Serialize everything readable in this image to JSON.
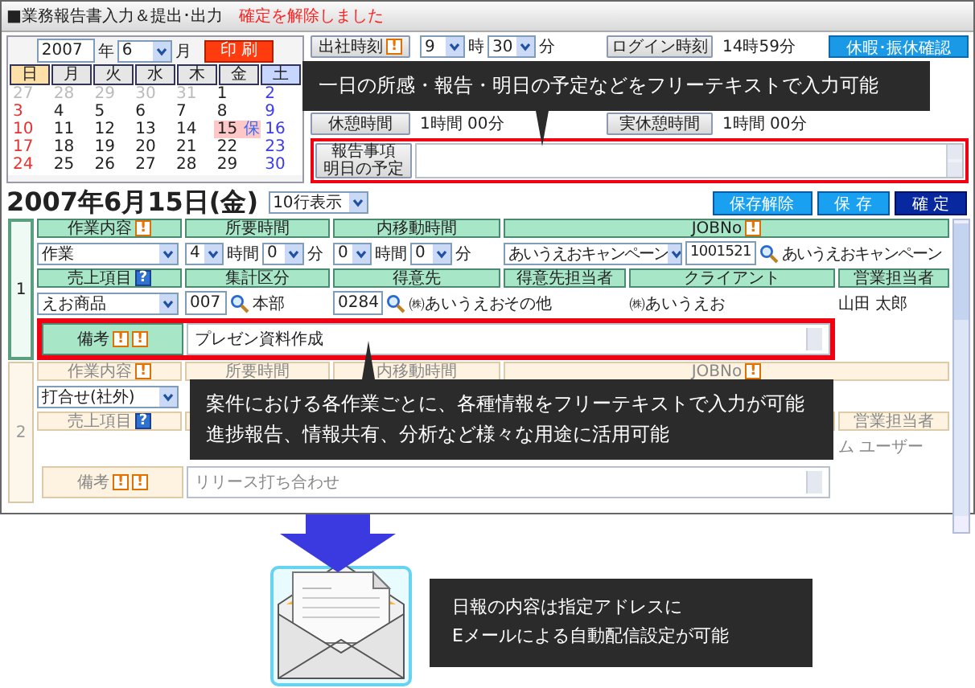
{
  "window": {
    "title": "■業務報告書入力＆提出･出力",
    "status": "確定を解除しました"
  },
  "calendar": {
    "year": "2007",
    "year_unit": "年",
    "month": "6",
    "month_unit": "月",
    "print_button": "印 刷",
    "weekdays": [
      {
        "label": "日",
        "kind": "sun"
      },
      {
        "label": "月",
        "kind": "weekday"
      },
      {
        "label": "火",
        "kind": "weekday"
      },
      {
        "label": "水",
        "kind": "weekday"
      },
      {
        "label": "木",
        "kind": "weekday"
      },
      {
        "label": "金",
        "kind": "weekday"
      },
      {
        "label": "土",
        "kind": "sat"
      }
    ],
    "weeks": [
      [
        {
          "day": "27",
          "kind": "other",
          "selected": false
        },
        {
          "day": "28",
          "kind": "other",
          "selected": false
        },
        {
          "day": "29",
          "kind": "other",
          "selected": false
        },
        {
          "day": "30",
          "kind": "other",
          "selected": false
        },
        {
          "day": "31",
          "kind": "other",
          "selected": false
        },
        {
          "day": "1",
          "kind": "weekday",
          "selected": false
        },
        {
          "day": "2",
          "kind": "sat",
          "selected": false
        }
      ],
      [
        {
          "day": "3",
          "kind": "sun",
          "selected": false
        },
        {
          "day": "4",
          "kind": "weekday",
          "selected": false
        },
        {
          "day": "5",
          "kind": "weekday",
          "selected": false
        },
        {
          "day": "6",
          "kind": "weekday",
          "selected": false
        },
        {
          "day": "7",
          "kind": "weekday",
          "selected": false
        },
        {
          "day": "8",
          "kind": "weekday",
          "selected": false
        },
        {
          "day": "9",
          "kind": "sat",
          "selected": false
        }
      ],
      [
        {
          "day": "10",
          "kind": "sun",
          "selected": false
        },
        {
          "day": "11",
          "kind": "weekday",
          "selected": false
        },
        {
          "day": "12",
          "kind": "weekday",
          "selected": false
        },
        {
          "day": "13",
          "kind": "weekday",
          "selected": false
        },
        {
          "day": "14",
          "kind": "weekday",
          "selected": false
        },
        {
          "day": "15",
          "kind": "weekday",
          "selected": true,
          "badge": "保"
        },
        {
          "day": "16",
          "kind": "sat",
          "selected": false
        }
      ],
      [
        {
          "day": "17",
          "kind": "sun",
          "selected": false
        },
        {
          "day": "18",
          "kind": "weekday",
          "selected": false
        },
        {
          "day": "19",
          "kind": "weekday",
          "selected": false
        },
        {
          "day": "20",
          "kind": "weekday",
          "selected": false
        },
        {
          "day": "21",
          "kind": "weekday",
          "selected": false
        },
        {
          "day": "22",
          "kind": "weekday",
          "selected": false
        },
        {
          "day": "23",
          "kind": "sat",
          "selected": false
        }
      ],
      [
        {
          "day": "24",
          "kind": "sun",
          "selected": false
        },
        {
          "day": "25",
          "kind": "weekday",
          "selected": false
        },
        {
          "day": "26",
          "kind": "weekday",
          "selected": false
        },
        {
          "day": "27",
          "kind": "weekday",
          "selected": false
        },
        {
          "day": "28",
          "kind": "weekday",
          "selected": false
        },
        {
          "day": "29",
          "kind": "weekday",
          "selected": false
        },
        {
          "day": "30",
          "kind": "sat",
          "selected": false
        }
      ]
    ]
  },
  "attendance": {
    "arrive": {
      "label": "出社時刻",
      "icons": [
        {
          "kind": "alert",
          "glyph": "!"
        }
      ],
      "hour": "9",
      "hour_unit": "時",
      "minute": "30",
      "minute_unit": "分"
    },
    "login": {
      "label": "ログイン時刻",
      "value": "14時59分"
    },
    "leave_button": "休暇･振休確認",
    "break": {
      "label": "休憩時間",
      "value": "1時間 00分"
    },
    "actual_break": {
      "label": "実休憩時間",
      "value": "1時間 00分"
    },
    "report": {
      "label_lines": [
        "報告事項",
        "明日の予定"
      ],
      "highlighted": true
    }
  },
  "day_header": {
    "date": "2007年6月15日(金)",
    "rows_select": "10行表示",
    "buttons": [
      {
        "label": "保存解除",
        "kind": "secondary"
      },
      {
        "label": "保 存",
        "kind": "secondary"
      },
      {
        "label": "確 定",
        "kind": "primary"
      }
    ]
  },
  "tasks": [
    {
      "number": "1",
      "active": true,
      "headers": {
        "work": {
          "label": "作業内容",
          "icons": [
            {
              "kind": "alert",
              "glyph": "!"
            }
          ]
        },
        "duration": {
          "label": "所要時間"
        },
        "travel": {
          "label": "内移動時間"
        },
        "job": {
          "label": "JOBNo",
          "icons": [
            {
              "kind": "alert",
              "glyph": "!"
            }
          ]
        },
        "sales_item": {
          "label": "売上項目",
          "icons": [
            {
              "kind": "help",
              "glyph": "?"
            }
          ]
        },
        "tally": {
          "label": "集計区分"
        },
        "customer": {
          "label": "得意先"
        },
        "customer_contact": {
          "label": "得意先担当者"
        },
        "client": {
          "label": "クライアント"
        },
        "sales_rep": {
          "label": "営業担当者"
        }
      },
      "values": {
        "work_type": "作業",
        "duration_hours": "4",
        "duration_hour_unit": "時間",
        "duration_minutes": "0",
        "duration_minute_unit": "分",
        "travel_hours": "0",
        "travel_hour_unit": "時間",
        "travel_minutes": "0",
        "travel_minute_unit": "分",
        "job_select": "あいうえおキャンペーン",
        "job_no": "1001521",
        "job_name": "あいうえおキャンペーン",
        "sales_item": "えお商品",
        "tally_code": "007",
        "tally_name": "本部",
        "customer_code": "0284",
        "customer_name": "㈱あいうえお",
        "customer_contact": "その他",
        "client": "㈱あいうえお",
        "sales_rep": "山田 太郎"
      },
      "note": {
        "label": "備考",
        "icons": [
          {
            "kind": "alert",
            "glyph": "!"
          },
          {
            "kind": "alert",
            "glyph": "!"
          }
        ],
        "text": "プレゼン資料作成",
        "highlighted": true
      }
    },
    {
      "number": "2",
      "active": false,
      "headers": {
        "work": {
          "label": "作業内容",
          "icons": [
            {
              "kind": "alert",
              "glyph": "!"
            }
          ]
        },
        "duration": {
          "label": "所要時間"
        },
        "travel": {
          "label": "内移動時間"
        },
        "job": {
          "label": "JOBNo",
          "icons": [
            {
              "kind": "alert",
              "glyph": "!"
            }
          ]
        },
        "sales_item": {
          "label": "売上項目",
          "icons": [
            {
              "kind": "help",
              "glyph": "?"
            }
          ]
        },
        "sales_rep": {
          "label": "営業担当者"
        }
      },
      "values": {
        "work_type": "打合せ(社外)",
        "sales_rep": "ム ユーザー"
      },
      "note": {
        "label": "備考",
        "icons": [
          {
            "kind": "alert",
            "glyph": "!"
          },
          {
            "kind": "alert",
            "glyph": "!"
          }
        ],
        "text": "リリース打ち合わせ",
        "highlighted": false
      }
    }
  ],
  "callouts": [
    {
      "lines": [
        "一日の所感・報告・明日の予定などをフリーテキストで入力可能"
      ],
      "kind": "down"
    },
    {
      "lines": [
        "案件における各作業ごとに、各種情報をフリーテキストで入力が可能",
        "進捗報告、情報共有、分析など様々な用途に活用可能"
      ],
      "kind": "up"
    }
  ],
  "mail_note": {
    "lines": [
      "日報の内容は指定アドレスに",
      "Eメールによる自動配信設定が可能"
    ]
  }
}
